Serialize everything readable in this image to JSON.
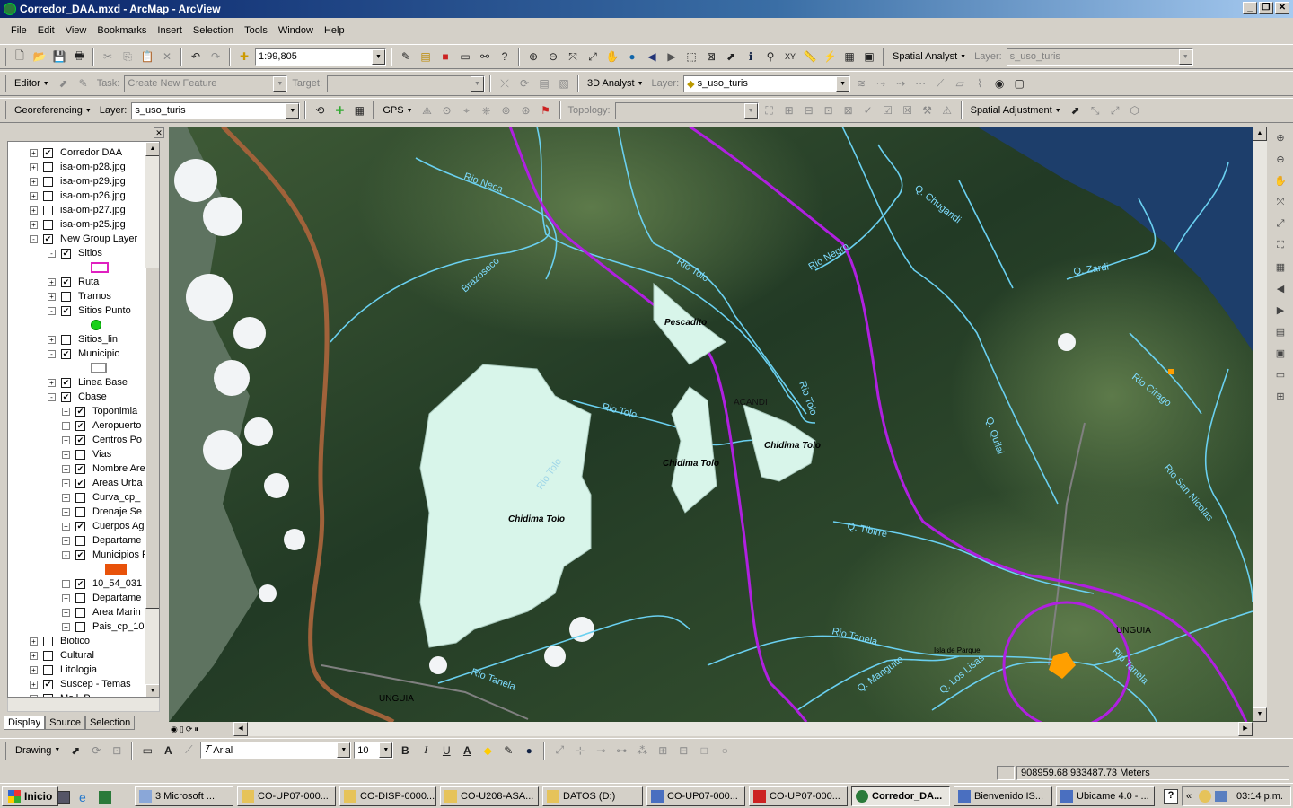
{
  "window": {
    "title": "Corredor_DAA.mxd - ArcMap - ArcView"
  },
  "menu": [
    "File",
    "Edit",
    "View",
    "Bookmarks",
    "Insert",
    "Selection",
    "Tools",
    "Window",
    "Help"
  ],
  "standard_toolbar": {
    "scale": "1:99,805",
    "spatial_analyst_label": "Spatial Analyst",
    "layer_label": "Layer:",
    "layer_value": "s_uso_turis"
  },
  "editor_toolbar": {
    "editor_label": "Editor",
    "task_label": "Task:",
    "task_value": "Create New Feature",
    "target_label": "Target:",
    "target_value": "",
    "analyst3d_label": "3D Analyst",
    "layer_label": "Layer:",
    "layer_value": "s_uso_turis"
  },
  "georef_toolbar": {
    "georef_label": "Georeferencing",
    "layer_label": "Layer:",
    "layer_value": "s_uso_turis",
    "gps_label": "GPS",
    "topology_label": "Topology:",
    "topology_value": "",
    "spatial_adj_label": "Spatial Adjustment"
  },
  "toc": {
    "tabs": [
      "Display",
      "Source",
      "Selection"
    ],
    "layers": [
      {
        "label": "Corredor DAA",
        "checked": true,
        "level": 0,
        "exp": "+"
      },
      {
        "label": "isa-om-p28.jpg",
        "checked": false,
        "level": 0,
        "exp": "+"
      },
      {
        "label": "isa-om-p29.jpg",
        "checked": false,
        "level": 0,
        "exp": "+"
      },
      {
        "label": "isa-om-p26.jpg",
        "checked": false,
        "level": 0,
        "exp": "+"
      },
      {
        "label": "isa-om-p27.jpg",
        "checked": false,
        "level": 0,
        "exp": "+"
      },
      {
        "label": "isa-om-p25.jpg",
        "checked": false,
        "level": 0,
        "exp": "+"
      },
      {
        "label": "New Group Layer",
        "checked": true,
        "level": 0,
        "exp": "-"
      },
      {
        "label": "Sitios",
        "checked": true,
        "level": 1,
        "exp": "-"
      },
      {
        "label": "",
        "swatch": "pink",
        "level": 1
      },
      {
        "label": "Ruta",
        "checked": true,
        "level": 1,
        "exp": "+"
      },
      {
        "label": "Tramos",
        "checked": false,
        "level": 1,
        "exp": "+"
      },
      {
        "label": "Sitios Punto",
        "checked": true,
        "level": 1,
        "exp": "-"
      },
      {
        "label": "",
        "swatch": "green",
        "level": 1
      },
      {
        "label": "Sitios_lin",
        "checked": false,
        "level": 1,
        "exp": "+"
      },
      {
        "label": "Municipio",
        "checked": true,
        "level": 1,
        "exp": "-"
      },
      {
        "label": "",
        "swatch": "outline",
        "level": 1
      },
      {
        "label": "Linea Base",
        "checked": true,
        "level": 1,
        "exp": "+"
      },
      {
        "label": "Cbase",
        "checked": true,
        "level": 1,
        "exp": "-"
      },
      {
        "label": "Toponimia",
        "checked": true,
        "level": 2,
        "exp": "+"
      },
      {
        "label": "Aeropuerto",
        "checked": true,
        "level": 2,
        "exp": "+"
      },
      {
        "label": "Centros Po",
        "checked": true,
        "level": 2,
        "exp": "+"
      },
      {
        "label": "Vias",
        "checked": false,
        "level": 2,
        "exp": "+"
      },
      {
        "label": "Nombre Are",
        "checked": true,
        "level": 2,
        "exp": "+"
      },
      {
        "label": "Areas Urba",
        "checked": true,
        "level": 2,
        "exp": "+"
      },
      {
        "label": "Curva_cp_",
        "checked": false,
        "level": 2,
        "exp": "+"
      },
      {
        "label": "Drenaje Se",
        "checked": false,
        "level": 2,
        "exp": "+"
      },
      {
        "label": "Cuerpos Ag",
        "checked": true,
        "level": 2,
        "exp": "+"
      },
      {
        "label": "Departame",
        "checked": false,
        "level": 2,
        "exp": "+"
      },
      {
        "label": "Municipios F",
        "checked": true,
        "level": 2,
        "exp": "-"
      },
      {
        "label": "",
        "swatch": "orange",
        "level": 2
      },
      {
        "label": "10_54_031",
        "checked": true,
        "level": 2,
        "exp": "+"
      },
      {
        "label": "Departame",
        "checked": false,
        "level": 2,
        "exp": "+"
      },
      {
        "label": "Area Marin",
        "checked": false,
        "level": 2,
        "exp": "+"
      },
      {
        "label": "Pais_cp_10",
        "checked": false,
        "level": 2,
        "exp": "+"
      },
      {
        "label": "Biotico",
        "checked": false,
        "level": 0,
        "exp": "+"
      },
      {
        "label": "Cultural",
        "checked": false,
        "level": 0,
        "exp": "+"
      },
      {
        "label": "Litologia",
        "checked": false,
        "level": 0,
        "exp": "+"
      },
      {
        "label": "Suscep - Temas",
        "checked": true,
        "level": 0,
        "exp": "+"
      },
      {
        "label": "Mall_P",
        "checked": false,
        "level": 0,
        "exp": "+"
      }
    ]
  },
  "map": {
    "rivers": [
      "Rio Neca",
      "Brazoseco",
      "Rio Tolo",
      "Rio Tolo",
      "Rio Tolo",
      "Rio Tolo",
      "Rio Negro",
      "Q. Chugandi",
      "Q. Zardi",
      "Rio Cirago",
      "Q. Quilal",
      "Rio San Nicolas",
      "Q. Tibirre",
      "Rio Tanela",
      "Rio Tanela",
      "Q. Manguito",
      "Q. Los Lisas",
      "Rio Tanela"
    ],
    "areas": [
      "Pescadito",
      "Chidima Tolo",
      "Chidima Tolo",
      "Chidima Tolo"
    ],
    "towns": [
      "ACANDI",
      "UNGUIA",
      "UNGUIA",
      "Isla de Parque"
    ],
    "colors": {
      "land": "#2f4a2f",
      "sea": "#1d3e6b",
      "river": "#6ad0f0",
      "boundary": "#b020e0",
      "road": "#a0623a",
      "area_fill": "#d8f5ea"
    }
  },
  "drawing_toolbar": {
    "drawing_label": "Drawing",
    "font_name": "Arial",
    "font_size": "10",
    "bold": "B",
    "italic": "I",
    "underline": "U",
    "text_a": "A"
  },
  "status": {
    "coordinates": "908959.68  933487.73 Meters"
  },
  "taskbar": {
    "start": "Inicio",
    "tasks": [
      "3 Microsoft ...",
      "CO-UP07-000...",
      "CO-DISP-0000...",
      "CO-U208-ASA...",
      "DATOS (D:)",
      "CO-UP07-000...",
      "CO-UP07-000...",
      "Corredor_DA...",
      "Bienvenido IS...",
      "Ubicame 4.0 - ..."
    ],
    "clock": "03:14 p.m."
  }
}
